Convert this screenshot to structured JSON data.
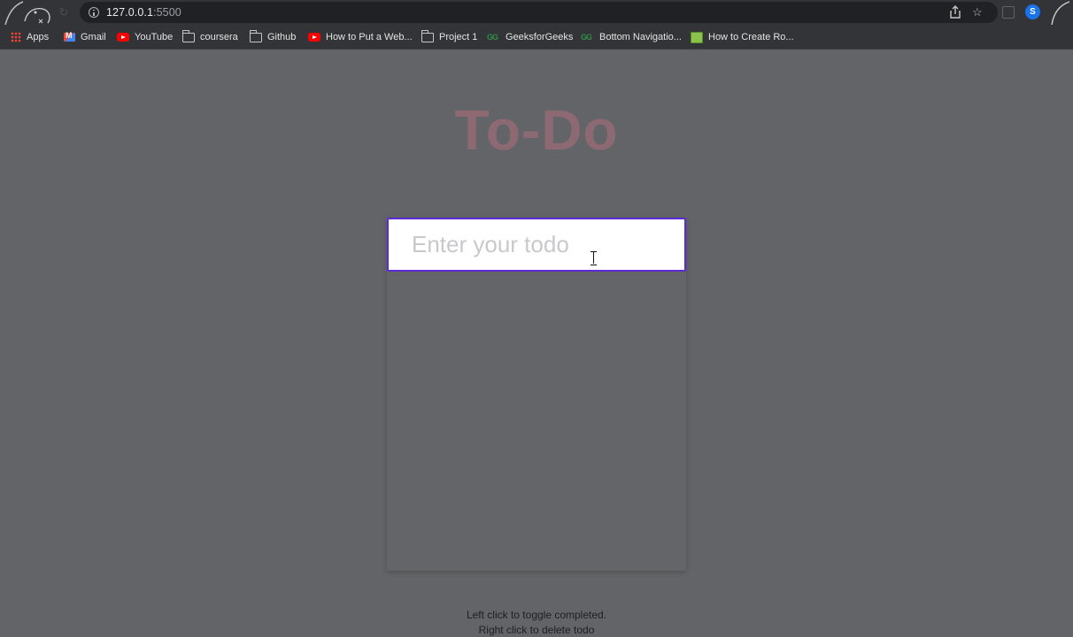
{
  "browser": {
    "url_host": "127.0.0.1",
    "url_port": ":5500",
    "profile_initial": "S",
    "bookmarks": [
      {
        "label": "Apps",
        "icon": "apps-grid-icon"
      },
      {
        "label": "Gmail",
        "icon": "gmail-icon"
      },
      {
        "label": "YouTube",
        "icon": "youtube-icon"
      },
      {
        "label": "coursera",
        "icon": "folder-icon"
      },
      {
        "label": "Github",
        "icon": "folder-icon"
      },
      {
        "label": "How to Put a Web...",
        "icon": "youtube-icon"
      },
      {
        "label": "Project 1",
        "icon": "folder-icon"
      },
      {
        "label": "GeeksforGeeks",
        "icon": "gfg-icon"
      },
      {
        "label": "Bottom Navigatio...",
        "icon": "gfg-icon"
      },
      {
        "label": "How to Create Ro...",
        "icon": "image-icon"
      }
    ]
  },
  "app": {
    "title": "To-Do",
    "input_placeholder": "Enter your todo",
    "todos": [],
    "instructions": [
      "Left click to toggle completed.",
      "Right click to delete todo"
    ]
  },
  "colors": {
    "background": "#636467",
    "title": "#8d6a73",
    "input_border": "#5b2bd6"
  }
}
